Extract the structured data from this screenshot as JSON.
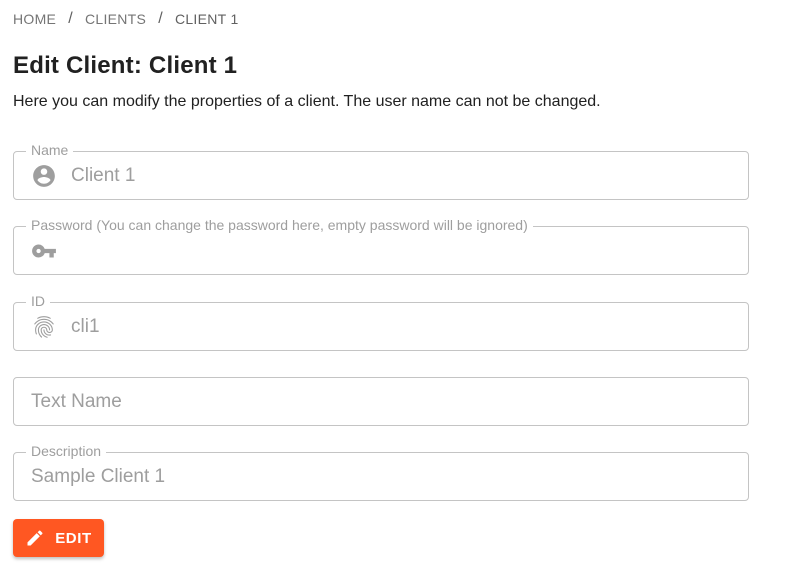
{
  "breadcrumb": {
    "items": [
      {
        "label": "HOME",
        "icon": null
      },
      {
        "label": "CLIENTS",
        "icon": null
      },
      {
        "label": "CLIENT 1",
        "icon": null
      }
    ],
    "separator": "/"
  },
  "header": {
    "title": "Edit Client: Client 1",
    "description": "Here you can modify the properties of a client. The user name can not be changed."
  },
  "form": {
    "name": {
      "label": "Name",
      "value": "Client 1",
      "icon": "account-circle-icon"
    },
    "password": {
      "label": "Password (You can change the password here, empty password will be ignored)",
      "value": "",
      "icon": "key-icon"
    },
    "id": {
      "label": "ID",
      "value": "cli1",
      "icon": "fingerprint-icon"
    },
    "text_name": {
      "label": "",
      "placeholder": "Text Name",
      "value": ""
    },
    "description": {
      "label": "Description",
      "value": "Sample Client 1"
    }
  },
  "actions": {
    "edit_label": "EDIT",
    "edit_icon": "pencil-icon"
  },
  "colors": {
    "accent": "#ff5722",
    "field_border": "#c4c4c4",
    "muted_text": "#9e9e9e",
    "icon_gray": "#9e9e9e"
  }
}
